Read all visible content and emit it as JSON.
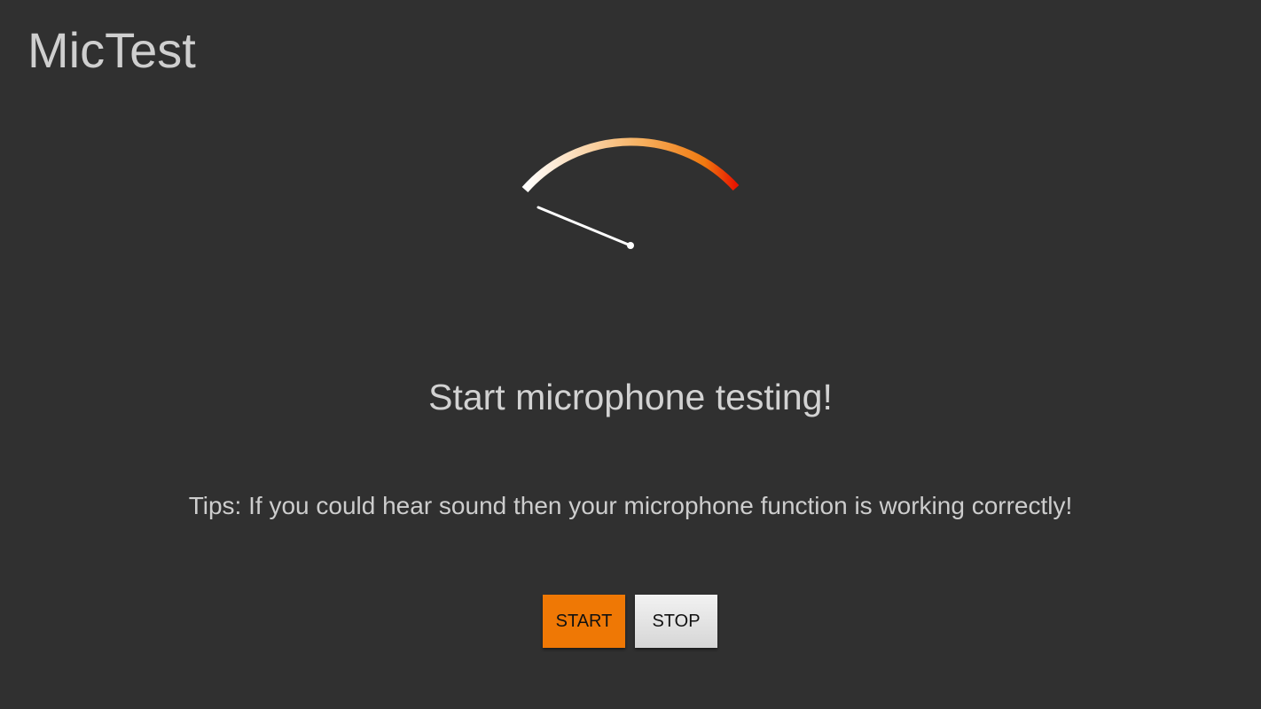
{
  "app": {
    "title": "MicTest"
  },
  "meter": {
    "level": 0,
    "gradient_colors": [
      "#ffffff",
      "#f4a040",
      "#ee1a00"
    ],
    "needle_color": "#ffffff"
  },
  "main": {
    "status_text": "Start microphone testing!",
    "tips_text": "Tips: If you could hear sound then your microphone function is working correctly!"
  },
  "controls": {
    "start_label": "START",
    "stop_label": "STOP",
    "start_color": "#ef7805"
  }
}
